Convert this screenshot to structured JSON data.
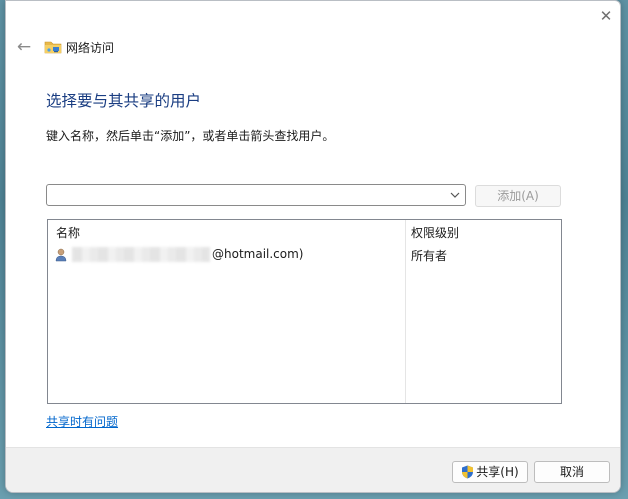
{
  "window": {
    "title": "网络访问",
    "close_glyph": "✕",
    "back_glyph": "←",
    "icons": [
      "back-arrow-icon",
      "network-folder-icon",
      "close-icon"
    ]
  },
  "main": {
    "heading": "选择要与其共享的用户",
    "instruction": "键入名称，然后单击“添加”，或者单击箭头查找用户。",
    "name_input": {
      "value": "",
      "placeholder": ""
    },
    "add_button": "添加(A)"
  },
  "list": {
    "columns": [
      "名称",
      "权限级别"
    ],
    "rows": [
      {
        "name_visible": "@hotmail.com)",
        "permission": "所有者",
        "icon": "user-icon"
      }
    ]
  },
  "help_link": "共享时有问题",
  "footer": {
    "share_button": "共享(H)",
    "cancel_button": "取消",
    "share_icon": "uac-shield-icon"
  },
  "colors": {
    "heading": "#1a3d82",
    "link": "#0066cc",
    "disabled_text": "#9b9b9b",
    "footer_bg": "#f0f0f0"
  }
}
